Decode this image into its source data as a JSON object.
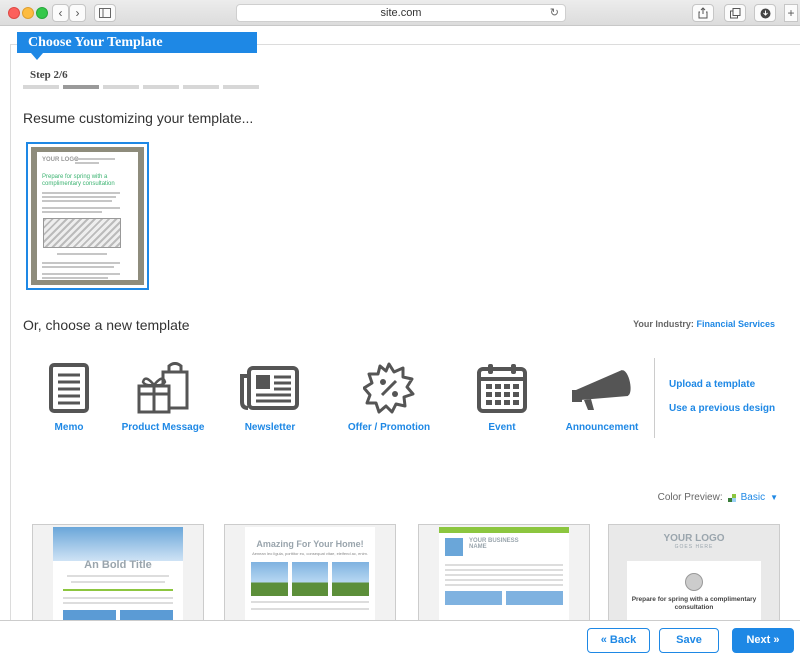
{
  "browser": {
    "url": "site.com",
    "back_icon": "‹",
    "forward_icon": "›",
    "reload_icon": "↻",
    "new_tab_icon": "+"
  },
  "header": {
    "title": "Choose Your Template",
    "step": "Step 2/6",
    "total_steps": 6,
    "current_step": 2
  },
  "resume": {
    "heading": "Resume customizing your template...",
    "thumb": {
      "logo": "YOUR LOGO",
      "headline": "Prepare for spring with a complimentary consultation"
    }
  },
  "choose": {
    "heading": "Or, choose a new template",
    "industry_label": "Your Industry:",
    "industry_value": "Financial Services",
    "types": [
      {
        "label": "Memo",
        "icon": "memo-icon"
      },
      {
        "label": "Product Message",
        "icon": "gift-bag-icon"
      },
      {
        "label": "Newsletter",
        "icon": "newspaper-icon"
      },
      {
        "label": "Offer / Promotion",
        "icon": "percent-badge-icon"
      },
      {
        "label": "Event",
        "icon": "calendar-icon"
      },
      {
        "label": "Announcement",
        "icon": "megaphone-icon"
      }
    ],
    "upload_link": "Upload a template",
    "previous_link": "Use a previous design"
  },
  "color_preview": {
    "label": "Color Preview:",
    "value": "Basic"
  },
  "templates": [
    {
      "title": "An Bold Title"
    },
    {
      "title": "Amazing For Your Home!",
      "subtitle": "Aenean leo ligula, porttitor eu, consequat vitae, eleifend ac, enim."
    },
    {
      "title": "YOUR BUSINESS",
      "subtitle": "NAME"
    },
    {
      "logo": "YOUR LOGO",
      "tagline": "GOES HERE",
      "headline": "Prepare for spring with a complimentary consultation"
    }
  ],
  "footer": {
    "back": "« Back",
    "save": "Save",
    "next": "Next »"
  },
  "colors": {
    "accent": "#1e88e5",
    "icon_gray": "#555555",
    "progress_active": "#9a9a9a",
    "progress_inactive": "#d7d7d7"
  }
}
